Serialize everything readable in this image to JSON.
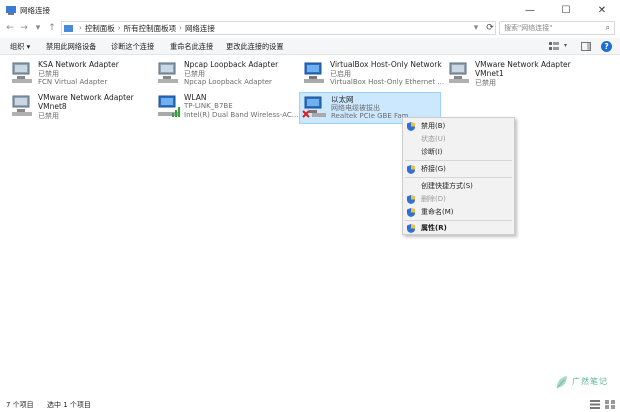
{
  "window": {
    "title": "网络连接"
  },
  "controls": {
    "minimize": "—",
    "maximize": "☐",
    "close": "✕"
  },
  "nav": {
    "back": "←",
    "forward": "→",
    "dropdown": "▾",
    "up": "↑",
    "refresh": "⟳",
    "path_dropdown": "▾"
  },
  "breadcrumb": [
    "控制面板",
    "所有控制面板项",
    "网络连接"
  ],
  "search": {
    "placeholder": "搜索\"网络连接\""
  },
  "toolbar": {
    "organize": "组织 ▾",
    "disable": "禁用此网络设备",
    "diagnose": "诊断这个连接",
    "rename": "重命名此连接",
    "change": "更改此连接的设置",
    "help": "?"
  },
  "adapters": [
    {
      "name": "KSA Network Adapter",
      "status": "已禁用",
      "device": "FCN Virtual Adapter",
      "icon": "network-adapter-icon"
    },
    {
      "name": "Npcap Loopback Adapter",
      "status": "已禁用",
      "device": "Npcap Loopback Adapter",
      "icon": "network-adapter-icon"
    },
    {
      "name": "VirtualBox Host-Only Network",
      "status": "已启用",
      "device": "VirtualBox Host-Only Ethernet ...",
      "icon": "network-adapter-icon"
    },
    {
      "name": "VMware Network Adapter",
      "name2": "VMnet1",
      "status": "已禁用",
      "icon": "network-adapter-icon"
    },
    {
      "name": "VMware Network Adapter",
      "name2": "VMnet8",
      "status": "已禁用",
      "icon": "network-adapter-icon"
    },
    {
      "name": "WLAN",
      "status": "TP-LINK_B7BE",
      "device": "Intel(R) Dual Band Wireless-AC...",
      "icon": "wifi-adapter-icon"
    },
    {
      "name": "以太网",
      "status": "网络电缆被拔出",
      "device": "Realtek PCIe GBE Fam",
      "icon": "ethernet-disconnected-icon"
    }
  ],
  "context_menu": {
    "disable": "禁用(B)",
    "status": "状态(U)",
    "diagnose": "诊断(I)",
    "bridge": "桥接(G)",
    "shortcut": "创建快捷方式(S)",
    "delete": "删除(D)",
    "rename": "重命名(M)",
    "properties": "属性(R)"
  },
  "statusbar": {
    "count": "7 个项目",
    "selected": "选中 1 个项目"
  },
  "watermark": {
    "text": "广然笔记"
  }
}
